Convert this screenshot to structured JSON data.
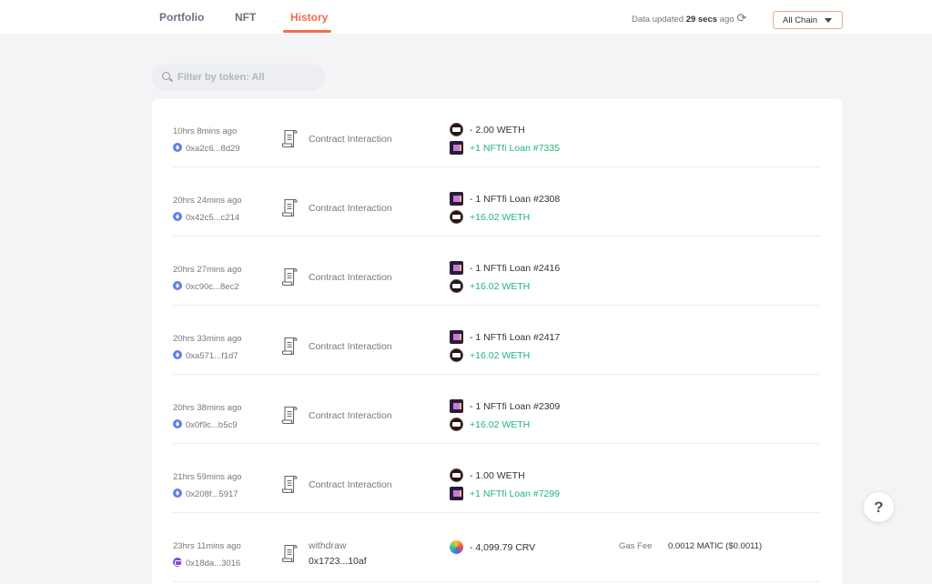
{
  "nav": {
    "tabs": [
      {
        "label": "Portfolio",
        "active": false
      },
      {
        "label": "NFT",
        "active": false
      },
      {
        "label": "History",
        "active": true
      }
    ]
  },
  "status": {
    "prefix": "Data updated",
    "age": "29 secs",
    "suffix": "ago",
    "refresh_icon": "refresh-icon"
  },
  "chain_select": {
    "value": "All Chain"
  },
  "filter": {
    "placeholder": "Filter by token: All"
  },
  "colors": {
    "accent": "#f26b4b",
    "positive": "#22b573",
    "ethereum": "#627eea",
    "polygon": "#8247e5"
  },
  "transactions": [
    {
      "time": "10hrs 8mins ago",
      "hash": "0xa2c6...8d29",
      "chain": "ethereum",
      "type": "Contract Interaction",
      "tokens": [
        {
          "icon": "weth-icon",
          "text": "- 2.00 WETH",
          "positive": false
        },
        {
          "icon": "nft-icon",
          "text": "+1 NFTfi Loan #7335",
          "positive": true
        }
      ]
    },
    {
      "time": "20hrs 24mins ago",
      "hash": "0x42c5...c214",
      "chain": "ethereum",
      "type": "Contract Interaction",
      "tokens": [
        {
          "icon": "nft-icon",
          "text": "- 1 NFTfi Loan #2308",
          "positive": false
        },
        {
          "icon": "weth-icon",
          "text": "+16.02 WETH",
          "positive": true
        }
      ]
    },
    {
      "time": "20hrs 27mins ago",
      "hash": "0xc90c...8ec2",
      "chain": "ethereum",
      "type": "Contract Interaction",
      "tokens": [
        {
          "icon": "nft-icon",
          "text": "- 1 NFTfi Loan #2416",
          "positive": false
        },
        {
          "icon": "weth-icon",
          "text": "+16.02 WETH",
          "positive": true
        }
      ]
    },
    {
      "time": "20hrs 33mins ago",
      "hash": "0xa571...f1d7",
      "chain": "ethereum",
      "type": "Contract Interaction",
      "tokens": [
        {
          "icon": "nft-icon",
          "text": "- 1 NFTfi Loan #2417",
          "positive": false
        },
        {
          "icon": "weth-icon",
          "text": "+16.02 WETH",
          "positive": true
        }
      ]
    },
    {
      "time": "20hrs 38mins ago",
      "hash": "0x0f9c...b5c9",
      "chain": "ethereum",
      "type": "Contract Interaction",
      "tokens": [
        {
          "icon": "nft-icon",
          "text": "- 1 NFTfi Loan #2309",
          "positive": false
        },
        {
          "icon": "weth-icon",
          "text": "+16.02 WETH",
          "positive": true
        }
      ]
    },
    {
      "time": "21hrs 59mins ago",
      "hash": "0x208f...5917",
      "chain": "ethereum",
      "type": "Contract Interaction",
      "tokens": [
        {
          "icon": "weth-icon",
          "text": "- 1.00 WETH",
          "positive": false
        },
        {
          "icon": "nft-icon",
          "text": "+1 NFTfi Loan #7299",
          "positive": true
        }
      ]
    },
    {
      "time": "23hrs 11mins ago",
      "hash": "0x18da...3016",
      "chain": "polygon",
      "type": "withdraw",
      "type_address": "0x1723...10af",
      "tokens": [
        {
          "icon": "crv-icon",
          "text": "- 4,099.79 CRV",
          "positive": false
        }
      ],
      "gas_label": "Gas Fee",
      "gas_value": "0.0012 MATIC ($0.0011)"
    }
  ],
  "help": {
    "label": "?"
  }
}
